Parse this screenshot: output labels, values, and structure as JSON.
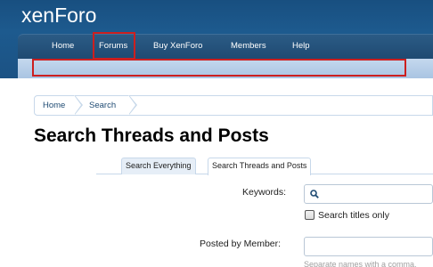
{
  "header": {
    "logo_left": "xen",
    "logo_right": "Foro"
  },
  "nav": {
    "items": [
      {
        "label": "Home"
      },
      {
        "label": "Forums"
      },
      {
        "label": "Buy XenForo"
      },
      {
        "label": "Members"
      },
      {
        "label": "Help"
      }
    ]
  },
  "breadcrumb": {
    "items": [
      "Home",
      "Search"
    ]
  },
  "page_title": "Search Threads and Posts",
  "tabs": [
    {
      "label": "Search Everything",
      "active": false
    },
    {
      "label": "Search Threads and Posts",
      "active": true
    }
  ],
  "form": {
    "keywords_label": "Keywords:",
    "keywords_value": "",
    "search_titles_label": "Search titles only",
    "search_titles_checked": false,
    "posted_by_label": "Posted by Member:",
    "posted_by_value": "",
    "posted_by_hint": "Separate names with a comma."
  },
  "colors": {
    "header_bg": "#1d5a8e",
    "annotation_outline": "#cc1f1f",
    "link": "#1f4b73"
  }
}
